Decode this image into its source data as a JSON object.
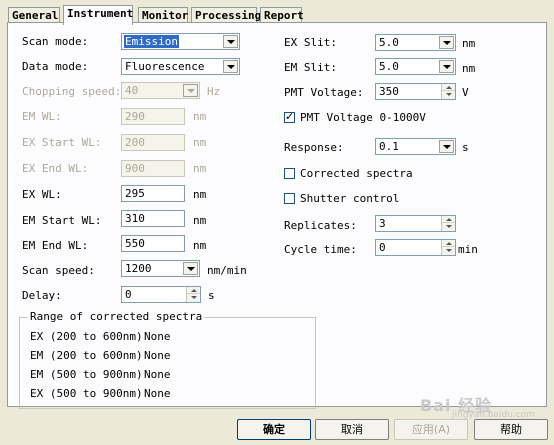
{
  "tabs": [
    "General",
    "Instrument",
    "Monitor",
    "Processing",
    "Report"
  ],
  "left": {
    "scan_mode": {
      "label": "Scan mode:",
      "value": "Emission"
    },
    "data_mode": {
      "label": "Data mode:",
      "value": "Fluorescence"
    },
    "chopping_speed": {
      "label": "Chopping speed:",
      "value": "40",
      "unit": "Hz"
    },
    "em_wl": {
      "label": "EM WL:",
      "value": "290",
      "unit": "nm"
    },
    "ex_start_wl": {
      "label": "EX Start WL:",
      "value": "200",
      "unit": "nm"
    },
    "ex_end_wl": {
      "label": "EX End WL:",
      "value": "900",
      "unit": "nm"
    },
    "ex_wl": {
      "label": "EX WL:",
      "value": "295",
      "unit": "nm"
    },
    "em_start_wl": {
      "label": "EM Start WL:",
      "value": "310",
      "unit": "nm"
    },
    "em_end_wl": {
      "label": "EM End WL:",
      "value": "550",
      "unit": "nm"
    },
    "scan_speed": {
      "label": "Scan speed:",
      "value": "1200",
      "unit": "nm/min"
    },
    "delay": {
      "label": "Delay:",
      "value": "0",
      "unit": "s"
    }
  },
  "right": {
    "ex_slit": {
      "label": "EX Slit:",
      "value": "5.0",
      "unit": "nm"
    },
    "em_slit": {
      "label": "EM Slit:",
      "value": "5.0",
      "unit": "nm"
    },
    "pmt_voltage": {
      "label": "PMT Voltage:",
      "value": "350",
      "unit": "V"
    },
    "pmt_range": {
      "label": "PMT Voltage 0-1000V",
      "checked": true
    },
    "response": {
      "label": "Response:",
      "value": "0.1",
      "unit": "s"
    },
    "corrected_spectra": {
      "label": "Corrected spectra",
      "checked": false
    },
    "shutter_control": {
      "label": "Shutter control",
      "checked": false
    },
    "replicates": {
      "label": "Replicates:",
      "value": "3"
    },
    "cycle_time": {
      "label": "Cycle time:",
      "value": "0",
      "unit": "min"
    }
  },
  "corrected_range": {
    "title": "Range of corrected spectra",
    "rows": [
      {
        "label": "EX (200 to 600nm)",
        "value": "None"
      },
      {
        "label": "EM (200 to 600nm)",
        "value": "None"
      },
      {
        "label": "EM (500 to 900nm)",
        "value": "None"
      },
      {
        "label": "EX (500 to 900nm)",
        "value": "None"
      }
    ]
  },
  "buttons": {
    "ok": "确定",
    "cancel": "取消",
    "apply": "应用(A)",
    "help": "帮助"
  },
  "watermark": {
    "text": "Bai 经验",
    "sub": "jingyan.baidu.com"
  }
}
